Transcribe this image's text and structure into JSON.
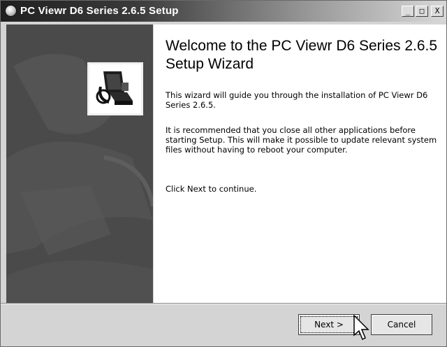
{
  "window": {
    "title": "PC Viewr D6 Series 2.6.5 Setup",
    "controls": {
      "minimize": "_",
      "maximize": "□",
      "close": "X"
    }
  },
  "content": {
    "heading": "Welcome to the PC Viewr D6 Series 2.6.5 Setup Wizard",
    "paragraph1": "This wizard will guide you through the installation of PC Viewr D6 Series 2.6.5.",
    "paragraph2": "It is recommended that you close all other applications before starting Setup. This will make it possible to update relevant system files without having to reboot your computer.",
    "paragraph3": "Click Next to continue."
  },
  "buttons": {
    "next_label": "Next >",
    "cancel_label": "Cancel"
  },
  "icons": [
    "app-icon",
    "installer-logo-icon",
    "mouse-cursor-icon"
  ]
}
